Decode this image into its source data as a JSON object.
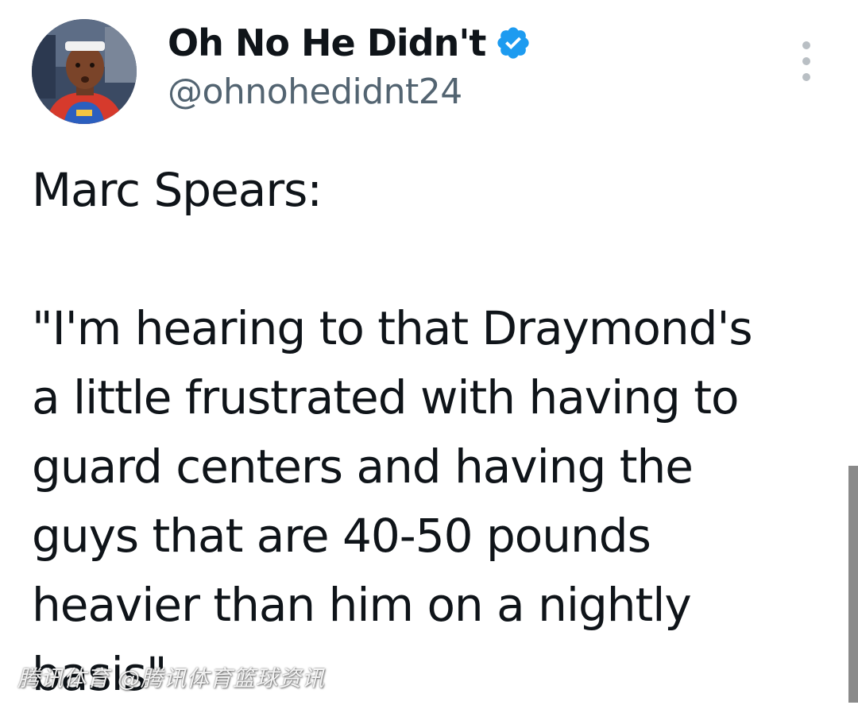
{
  "author": {
    "display_name": "Oh No He Didn't",
    "handle": "@ohnohedidnt24",
    "verified": true,
    "avatar": "player-portrait-avatar"
  },
  "menu": {
    "icon": "more-vertical-icon"
  },
  "tweet": {
    "lines": [
      "Marc Spears:",
      "",
      "\"I'm hearing to that Draymond's",
      "a little frustrated with having to",
      "guard centers and having the",
      "guys that are 40-50 pounds",
      "heavier than him on a nightly",
      "basis\""
    ]
  },
  "watermark": {
    "text": "腾讯体育 @腾讯体育篮球资讯"
  },
  "colors": {
    "text": "#0f1419",
    "secondary": "#536471",
    "verified_badge": "#1d9bf0"
  }
}
